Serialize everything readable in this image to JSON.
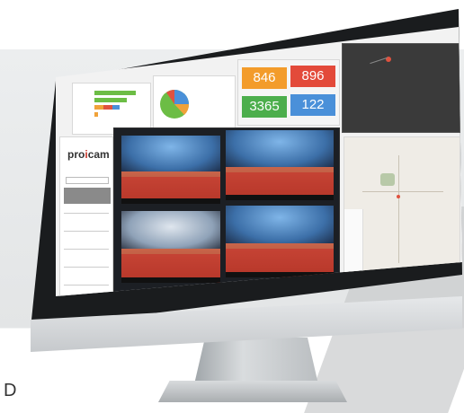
{
  "background_letter": "D",
  "dashboard": {
    "logo_text_a": "pro",
    "logo_text_b": "i",
    "logo_text_c": "cam",
    "stats": [
      {
        "value": "846",
        "color": "#f39c2b"
      },
      {
        "value": "896",
        "color": "#e34a3a"
      },
      {
        "value": "3365",
        "color": "#4cae4c"
      },
      {
        "value": "122",
        "color": "#4a90d9"
      }
    ],
    "colors": {
      "green": "#6cbd45",
      "orange": "#f0a23a",
      "red": "#e0523f",
      "blue": "#4a90d9",
      "dark_map": "#3a3a3a"
    }
  }
}
